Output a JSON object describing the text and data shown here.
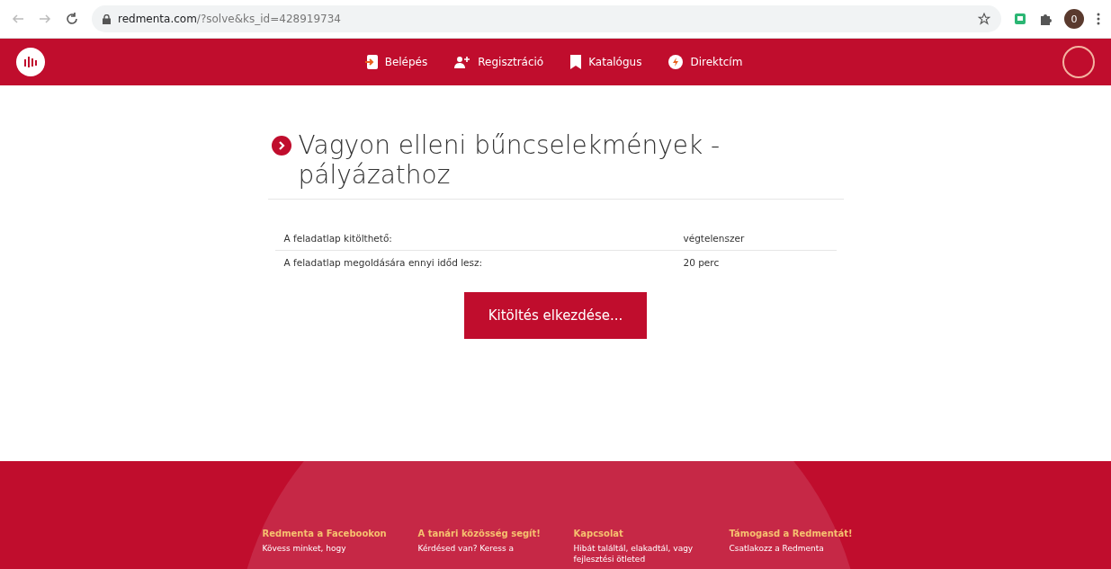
{
  "browser": {
    "url_host": "redmenta.com",
    "url_path": "/?solve&ks_id=428919734",
    "profile_initial": "0"
  },
  "nav": {
    "items": [
      {
        "label": "Belépés",
        "kind": "login"
      },
      {
        "label": "Regisztráció",
        "kind": "register"
      },
      {
        "label": "Katalógus",
        "kind": "catalog"
      },
      {
        "label": "Direktcím",
        "kind": "direct"
      }
    ]
  },
  "title": "Vagyon elleni bűncselekmények - pályázathoz",
  "info_rows": [
    {
      "label": "A feladatlap kitölthető:",
      "value": "végtelenszer"
    },
    {
      "label": "A feladatlap megoldására ennyi időd lesz:",
      "value": "20 perc"
    }
  ],
  "start_button": "Kitöltés elkezdése...",
  "footer": {
    "columns": [
      {
        "heading": "Redmenta a Facebookon",
        "text": "Kövess minket, hogy"
      },
      {
        "heading": "A tanári közösség segít!",
        "text": "Kérdésed van? Keress a"
      },
      {
        "heading": "Kapcsolat",
        "text": "Hibát találtál, elakadtál, vagy fejlesztési ötleted"
      },
      {
        "heading": "Támogasd a Redmentát!",
        "text": "Csatlakozz a Redmenta"
      }
    ]
  }
}
